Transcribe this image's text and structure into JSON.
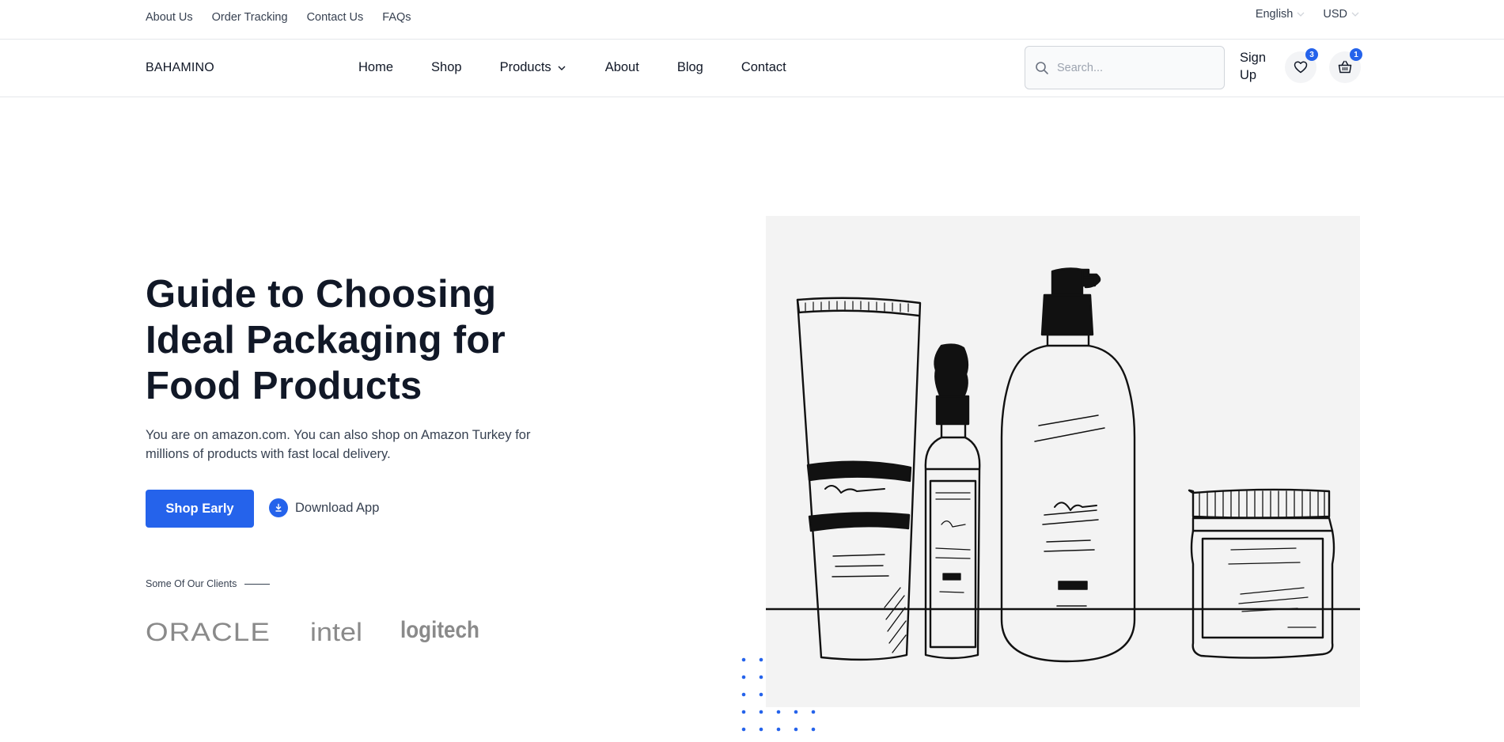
{
  "topbar": {
    "links": [
      "About Us",
      "Order Tracking",
      "Contact Us",
      "FAQs"
    ],
    "language": "English",
    "currency": "USD"
  },
  "navbar": {
    "logo": "BAHAMINO",
    "menu": [
      "Home",
      "Shop",
      "Products",
      "About",
      "Blog",
      "Contact"
    ],
    "search_placeholder": "Search...",
    "signup_label": "Sign Up",
    "wishlist_count": "3",
    "cart_count": "1"
  },
  "hero": {
    "title": "Guide to Choosing Ideal Packaging for Food Products",
    "description": "You are on amazon.com. You can also shop on Amazon Turkey for millions of products with fast local delivery.",
    "primary_button": "Shop Early",
    "download_button": "Download App",
    "clients_label": "Some Of Our Clients",
    "client_logos": [
      "ORACLE",
      "intel",
      "logitech"
    ]
  },
  "icons": [
    "chevron-down-icon",
    "search-icon",
    "heart-icon",
    "basket-icon",
    "download-icon"
  ],
  "colors": {
    "accent": "#2563eb",
    "text": "#111827",
    "muted": "#374151",
    "logo_gray": "#8a8a8a",
    "image_bg": "#f3f3f3"
  }
}
